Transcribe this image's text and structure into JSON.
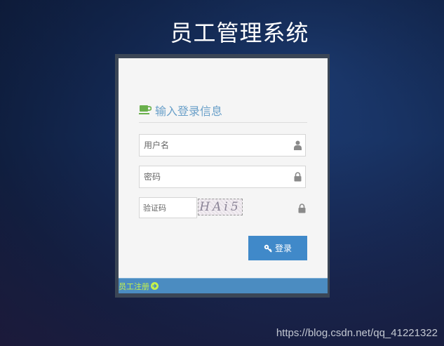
{
  "app": {
    "title": "员工管理系统"
  },
  "login": {
    "heading": "输入登录信息",
    "username": {
      "placeholder": "用户名",
      "value": ""
    },
    "password": {
      "placeholder": "密码",
      "value": ""
    },
    "captcha": {
      "placeholder": "验证码",
      "value": "",
      "image_text": "HAi5"
    },
    "submit_label": "登录"
  },
  "footer": {
    "register_label": "员工注册"
  },
  "watermark": "https://blog.csdn.net/qq_41221322",
  "colors": {
    "accent": "#4089c9",
    "heading": "#6aa0c9",
    "cup_icon": "#6ab04c",
    "register_link": "#c6f24a"
  }
}
